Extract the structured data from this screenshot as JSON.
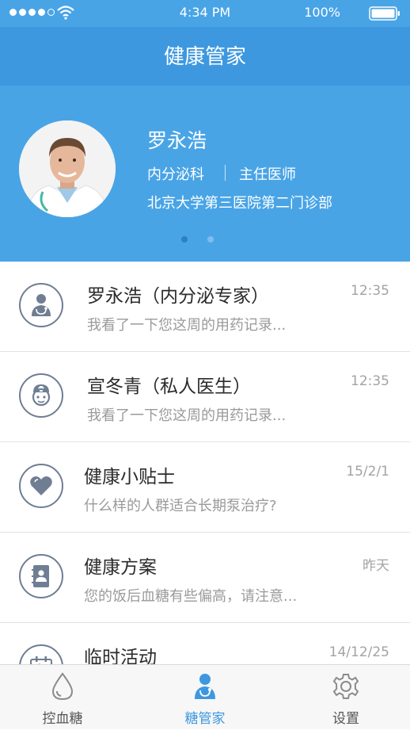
{
  "status_bar": {
    "time": "4:34 PM",
    "battery": "100%"
  },
  "nav": {
    "title": "健康管家"
  },
  "profile": {
    "name": "罗永浩",
    "department": "内分泌科",
    "position": "主任医师",
    "hospital": "北京大学第三医院第二门诊部",
    "page_count": 2,
    "active_page": 1
  },
  "messages": [
    {
      "title": "罗永浩（内分泌专家）",
      "subtitle": "我看了一下您这周的用药记录...",
      "time": "12:35",
      "icon": "doctor-icon"
    },
    {
      "title": "宣冬青（私人医生）",
      "subtitle": "我看了一下您这周的用药记录...",
      "time": "12:35",
      "icon": "nurse-icon"
    },
    {
      "title": "健康小贴士",
      "subtitle": "什么样的人群适合长期泵治疗?",
      "time": "15/2/1",
      "icon": "heart-icon"
    },
    {
      "title": "健康方案",
      "subtitle": "您的饭后血糖有些偏高，请注意...",
      "time": "昨天",
      "icon": "contact-book-icon"
    },
    {
      "title": "临时活动",
      "subtitle": "",
      "time": "14/12/25",
      "icon": "activity-icon"
    }
  ],
  "tabs": [
    {
      "label": "控血糖",
      "icon": "drop-icon",
      "active": false
    },
    {
      "label": "糖管家",
      "icon": "doctor-icon",
      "active": true
    },
    {
      "label": "设置",
      "icon": "gear-icon",
      "active": false
    }
  ],
  "colors": {
    "primary": "#49a4e6",
    "navbar": "#3e98df",
    "icon_gray": "#6f7e92",
    "active_tab": "#3e98df"
  }
}
